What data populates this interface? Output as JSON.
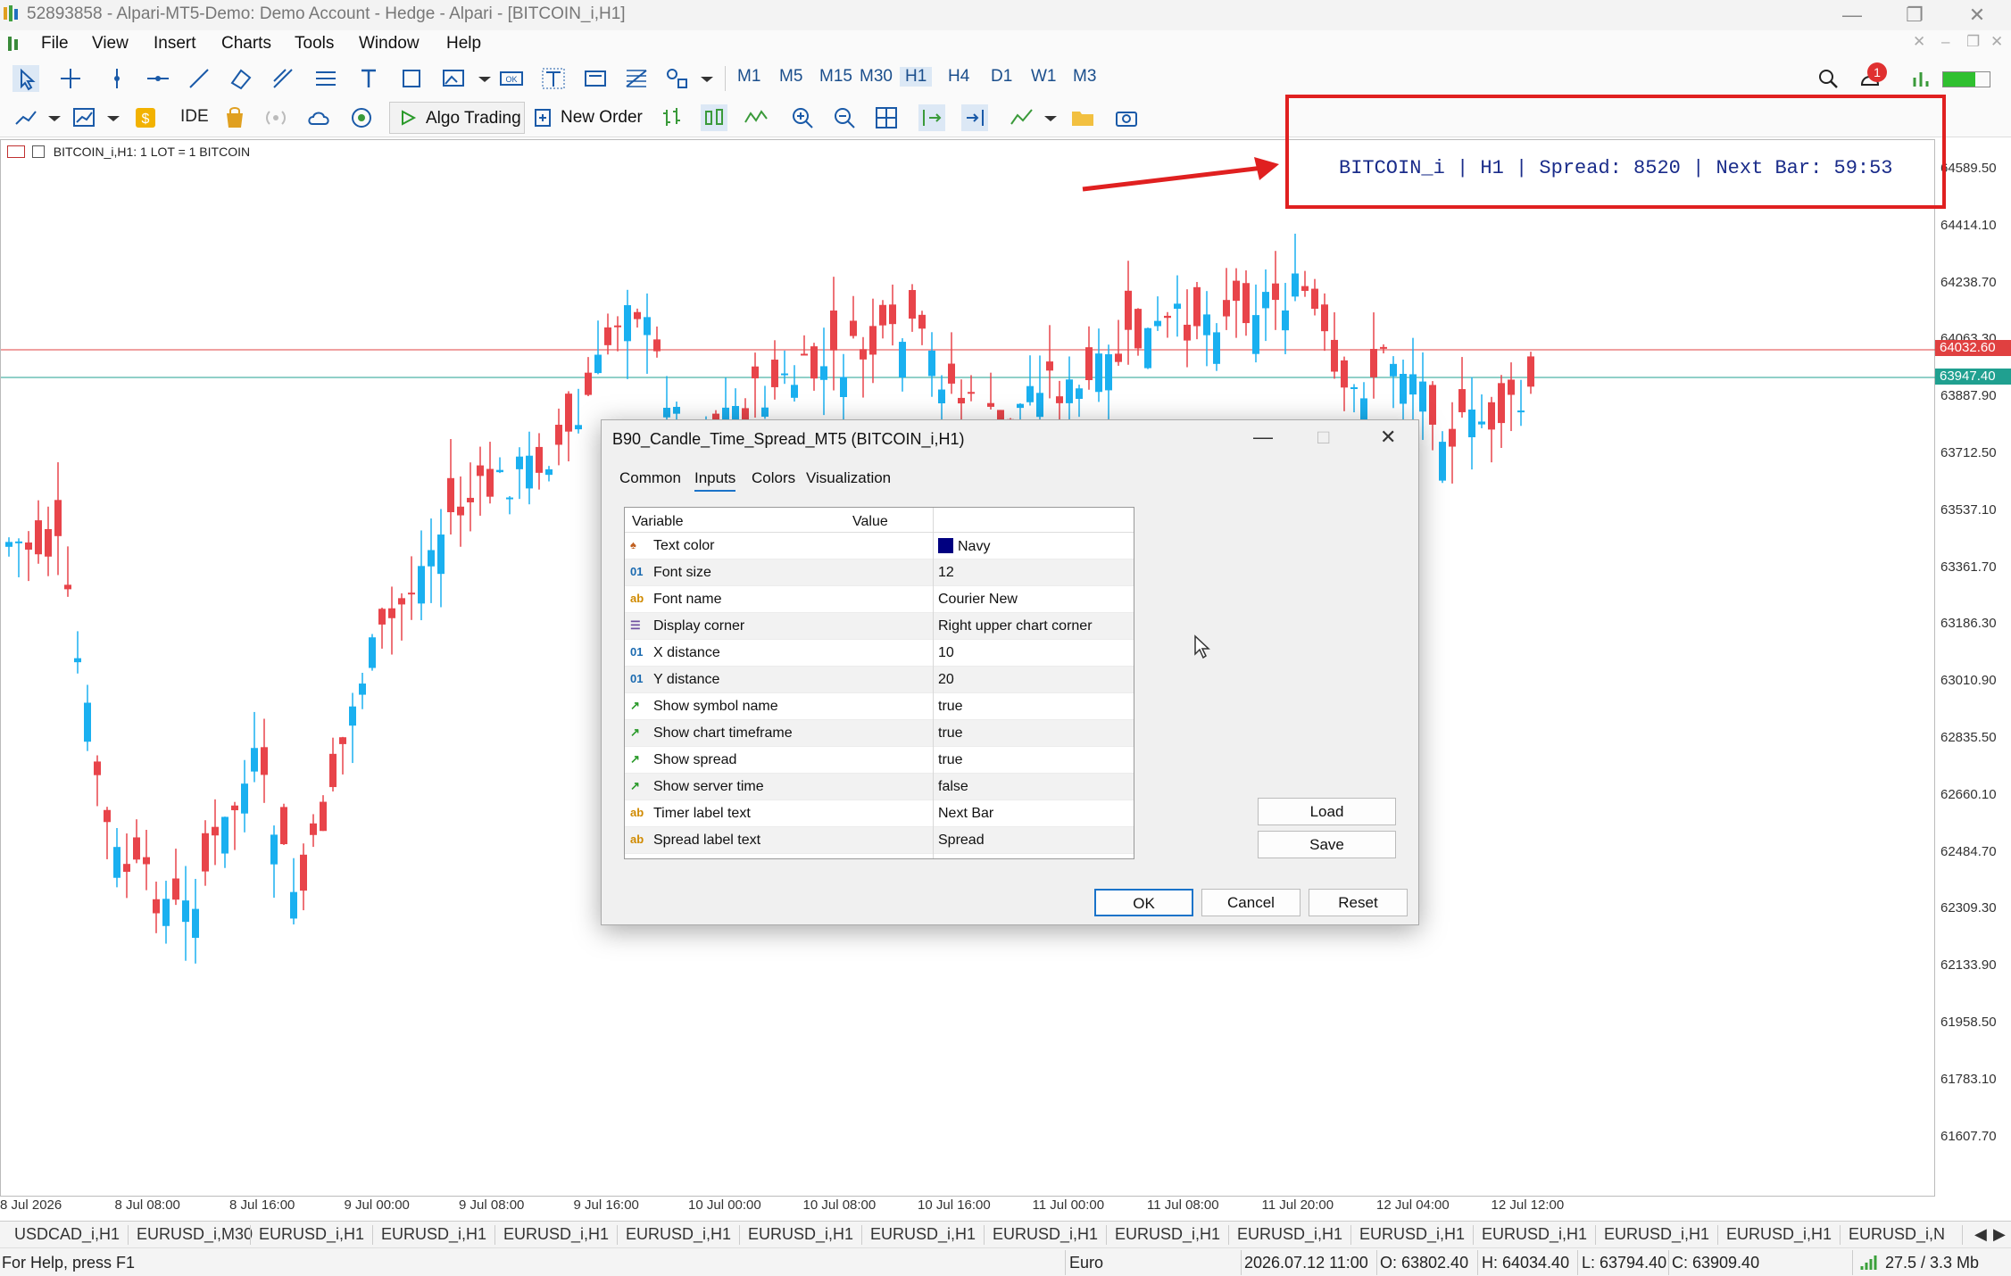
{
  "window": {
    "title": "52893858 - Alpari-MT5-Demo: Demo Account - Hedge - Alpari - [BITCOIN_i,H1]"
  },
  "menu": [
    "File",
    "View",
    "Insert",
    "Charts",
    "Tools",
    "Window",
    "Help"
  ],
  "timeframes": [
    "M1",
    "M5",
    "M15",
    "M30",
    "H1",
    "H4",
    "D1",
    "W1",
    "M3"
  ],
  "toolbar": {
    "ide_label": "IDE",
    "algo_trading_label": "Algo Trading",
    "new_order_label": "New Order",
    "notification_count": "1"
  },
  "chart": {
    "header": "BITCOIN_i,H1:  1 LOT = 1 BITCOIN",
    "overlay_text": "BITCOIN_i | H1 | Spread: 8520 | Next Bar: 59:53",
    "price_labels": [
      "64589.50",
      "64414.10",
      "64238.70",
      "64063.30",
      "63887.90",
      "63712.50",
      "63537.10",
      "63361.70",
      "63186.30",
      "63010.90",
      "62835.50",
      "62660.10",
      "62484.70",
      "62309.30",
      "62133.90",
      "61958.50",
      "61783.10",
      "61607.70"
    ],
    "ask_tag": "64032.60",
    "bid_tag": "63947.40",
    "ask_color": "#e04040",
    "bid_color": "#20a090",
    "time_labels": [
      "8 Jul 2026",
      "8 Jul 08:00",
      "8 Jul 16:00",
      "9 Jul 00:00",
      "9 Jul 08:00",
      "9 Jul 16:00",
      "10 Jul 00:00",
      "10 Jul 08:00",
      "10 Jul 16:00",
      "11 Jul 00:00",
      "11 Jul 08:00",
      "11 Jul 20:00",
      "12 Jul 04:00",
      "12 Jul 12:00"
    ],
    "bull_color": "#1ab0f0",
    "bear_color": "#e8444a"
  },
  "dialog": {
    "title": "B90_Candle_Time_Spread_MT5 (BITCOIN_i,H1)",
    "tabs": [
      "Common",
      "Inputs",
      "Colors",
      "Visualization"
    ],
    "active_tab": "Inputs",
    "columns": {
      "variable": "Variable",
      "value": "Value"
    },
    "rows": [
      {
        "icon": "color-icon",
        "variable": "Text color",
        "value": "Navy"
      },
      {
        "icon": "int-icon",
        "variable": "Font size",
        "value": "12"
      },
      {
        "icon": "string-icon",
        "variable": "Font name",
        "value": "Courier New"
      },
      {
        "icon": "enum-icon",
        "variable": "Display corner",
        "value": "Right upper chart corner"
      },
      {
        "icon": "int-icon",
        "variable": "X distance",
        "value": "10"
      },
      {
        "icon": "int-icon",
        "variable": "Y distance",
        "value": "20"
      },
      {
        "icon": "bool-icon",
        "variable": "Show symbol name",
        "value": "true"
      },
      {
        "icon": "bool-icon",
        "variable": "Show chart timeframe",
        "value": "true"
      },
      {
        "icon": "bool-icon",
        "variable": "Show spread",
        "value": "true"
      },
      {
        "icon": "bool-icon",
        "variable": "Show server time",
        "value": "false"
      },
      {
        "icon": "string-icon",
        "variable": "Timer label text",
        "value": "Next Bar"
      },
      {
        "icon": "string-icon",
        "variable": "Spread label text",
        "value": "Spread"
      }
    ],
    "buttons": {
      "load": "Load",
      "save": "Save",
      "ok": "OK",
      "cancel": "Cancel",
      "reset": "Reset"
    },
    "swatch_color": "#000080"
  },
  "chart_tabs": [
    "USDCAD_i,H1",
    "EURUSD_i,M30",
    "EURUSD_i,H1",
    "EURUSD_i,H1",
    "EURUSD_i,H1",
    "EURUSD_i,H1",
    "EURUSD_i,H1",
    "EURUSD_i,H1",
    "EURUSD_i,H1",
    "EURUSD_i,H1",
    "EURUSD_i,H1",
    "EURUSD_i,H1",
    "EURUSD_i,H1",
    "EURUSD_i,H1",
    "EURUSD_i,H1",
    "EURUSD_i,N"
  ],
  "status": {
    "help": "For Help, press F1",
    "profile": "Euro",
    "datetime": "2026.07.12 11:00",
    "open": "O: 63802.40",
    "high": "H: 64034.40",
    "low": "L: 63794.40",
    "close": "C: 63909.40",
    "traffic": "27.5 / 3.3 Mb"
  }
}
